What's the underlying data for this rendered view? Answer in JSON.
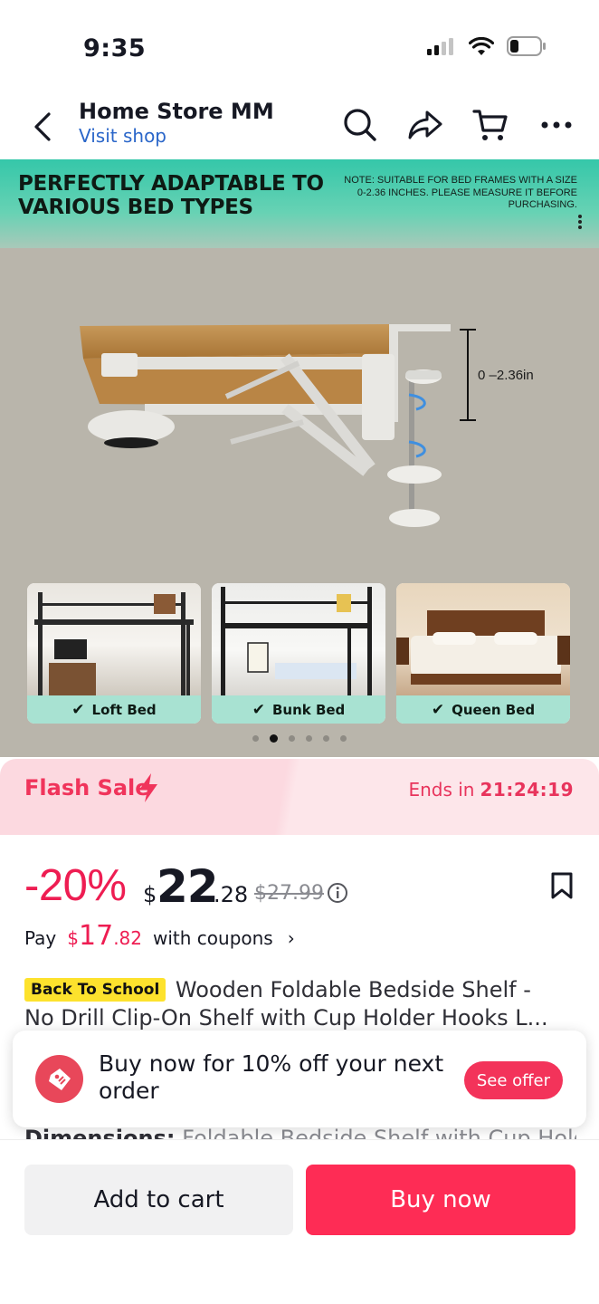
{
  "status_bar": {
    "time": "9:35"
  },
  "header": {
    "shop_name": "Home Store MM",
    "visit_shop": "Visit shop",
    "icons": [
      "back-icon",
      "search-icon",
      "share-icon",
      "cart-icon",
      "more-icon"
    ]
  },
  "hero": {
    "title": "PERFECTLY ADAPTABLE TO VARIOUS BED TYPES",
    "note": "NOTE: SUITABLE FOR BED FRAMES WITH A SIZE 0-2.36 INCHES. PLEASE MEASURE IT BEFORE PURCHASING.",
    "measure": "0 –2.36in",
    "thumbnails": [
      {
        "label": "Loft Bed"
      },
      {
        "label": "Bunk Bed"
      },
      {
        "label": "Queen Bed"
      }
    ],
    "active_dot": 1,
    "dot_count": 6
  },
  "flash_sale": {
    "title": "Flash Sale",
    "ends_label": "Ends in",
    "countdown": "21:24:19",
    "accent": "#f0345b"
  },
  "price": {
    "discount": "-20%",
    "currency": "$",
    "integer": "22",
    "decimal": ".28",
    "original": "$27.99"
  },
  "coupon": {
    "pay": "Pay",
    "currency": "$",
    "integer": "17",
    "decimal": ".82",
    "text": "with coupons",
    "chevron": "›"
  },
  "product": {
    "tag": "Back To School",
    "title_line1": "Wooden Foldable Bedside Shelf -",
    "title_line2": "No Drill Clip-On Shelf with Cup Holder Hooks L...",
    "dims_label": "Dimensions:",
    "dims_value": "Foldable Bedside Shelf with Cup Holder"
  },
  "offer": {
    "text": "Buy now for 10% off your next order",
    "button": "See offer"
  },
  "actions": {
    "add_to_cart": "Add to cart",
    "buy_now": "Buy now",
    "brand_color": "#fe2c55"
  }
}
